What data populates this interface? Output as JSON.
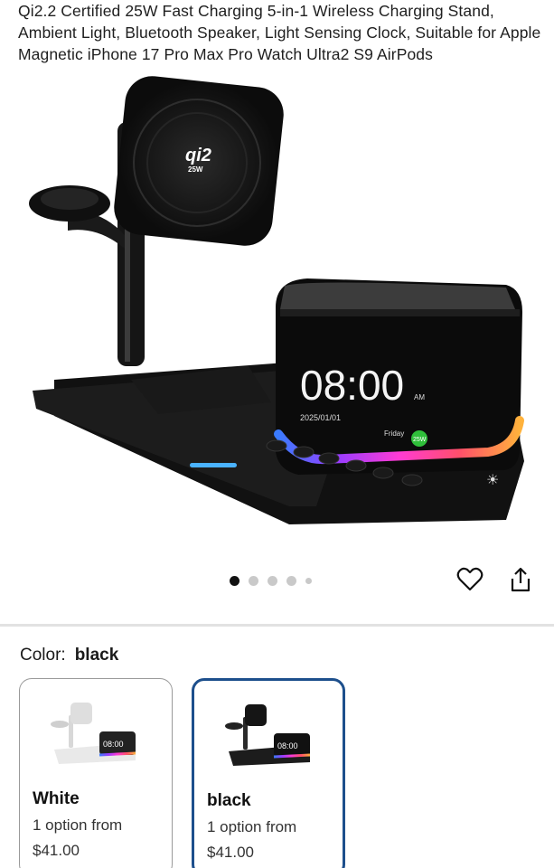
{
  "product": {
    "title": "Qi2.2 Certified 25W Fast Charging 5-in-1 Wireless Charging Stand, Ambient Light, Bluetooth Speaker, Light Sensing Clock, Suitable for Apple Magnetic iPhone 17 Pro Max Pro Watch Ultra2 S9 AirPods"
  },
  "hero": {
    "clock_time": "08:00",
    "clock_ampm": "AM",
    "clock_date": "2025/01/01",
    "clock_day": "Friday",
    "clock_badge": "25W",
    "qi_logo_top": "qi2",
    "qi_logo_bottom": "25W"
  },
  "gallery": {
    "image_count": 5,
    "active_index": 0
  },
  "actions": {
    "favorite_icon": "heart-icon",
    "share_icon": "share-icon"
  },
  "color": {
    "label": "Color:",
    "selected": "black",
    "options": [
      {
        "name": "White",
        "sub": "1 option from",
        "price": "$41.00"
      },
      {
        "name": "black",
        "sub": "1 option from",
        "price": "$41.00"
      }
    ]
  },
  "colors": {
    "selected_border": "#1d4f8c",
    "divider": "#e2e2e2"
  }
}
